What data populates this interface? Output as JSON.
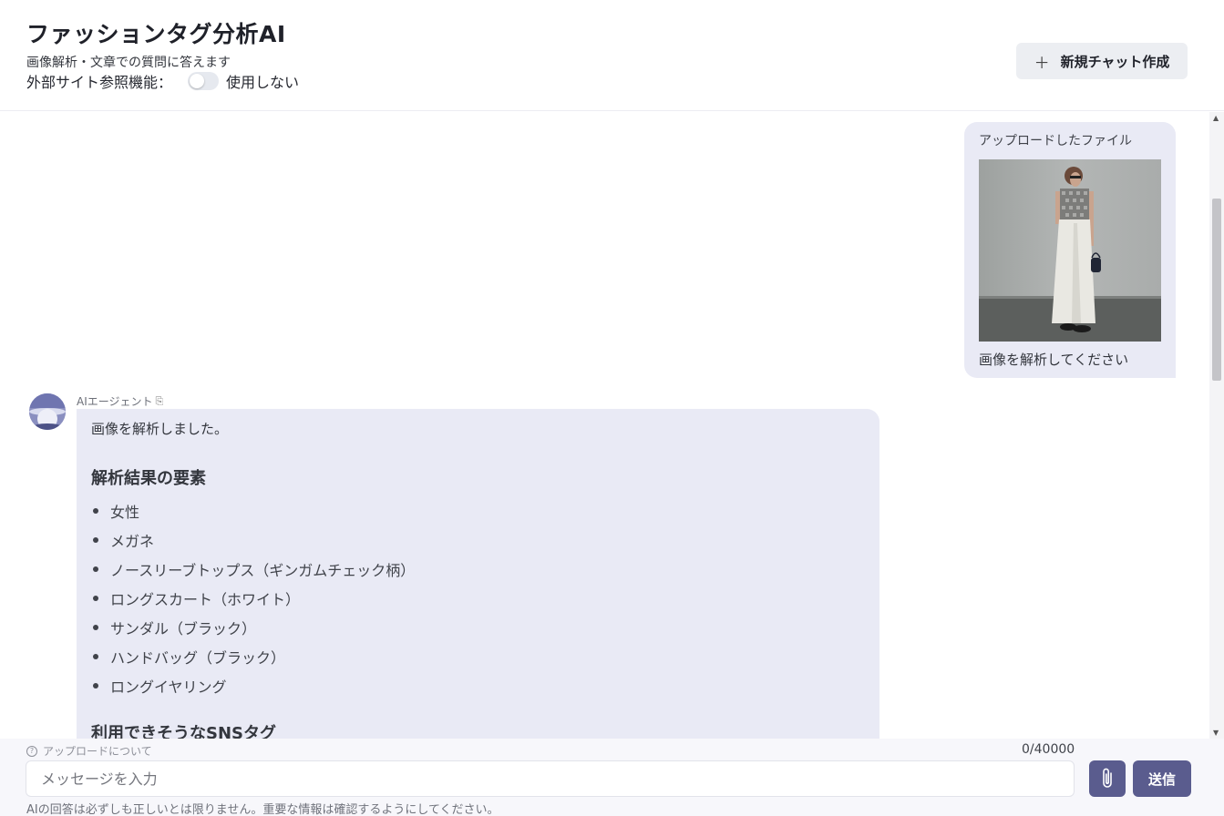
{
  "header": {
    "title": "ファッションタグ分析AI",
    "subtitle": "画像解析・文章での質問に答えます",
    "external_label": "外部サイト参照機能：",
    "external_state": "使用しない",
    "new_chat_label": "新規チャット作成"
  },
  "user_message": {
    "file_label": "アップロードしたファイル",
    "text": "画像を解析してください"
  },
  "ai_message": {
    "agent_name": "AIエージェント",
    "intro": "画像を解析しました。",
    "heading_elements": "解析結果の要素",
    "elements": [
      "女性",
      "メガネ",
      "ノースリーブトップス（ギンガムチェック柄）",
      "ロングスカート（ホワイト）",
      "サンダル（ブラック）",
      "ハンドバッグ（ブラック）",
      "ロングイヤリング"
    ],
    "heading_tags": "利用できそうなSNSタグ"
  },
  "input": {
    "upload_about": "アップロードについて",
    "char_count": "0/40000",
    "placeholder": "メッセージを入力",
    "send_label": "送信",
    "disclaimer": "AIの回答は必ずしも正しいとは限りません。重要な情報は確認するようにしてください。"
  },
  "colors": {
    "bubble": "#e9eaf5",
    "accent": "#5a5c8e",
    "new_chat_bg": "#eceef2"
  },
  "icons": [
    "plus-icon",
    "help-icon",
    "paperclip-icon",
    "agent-icon"
  ]
}
